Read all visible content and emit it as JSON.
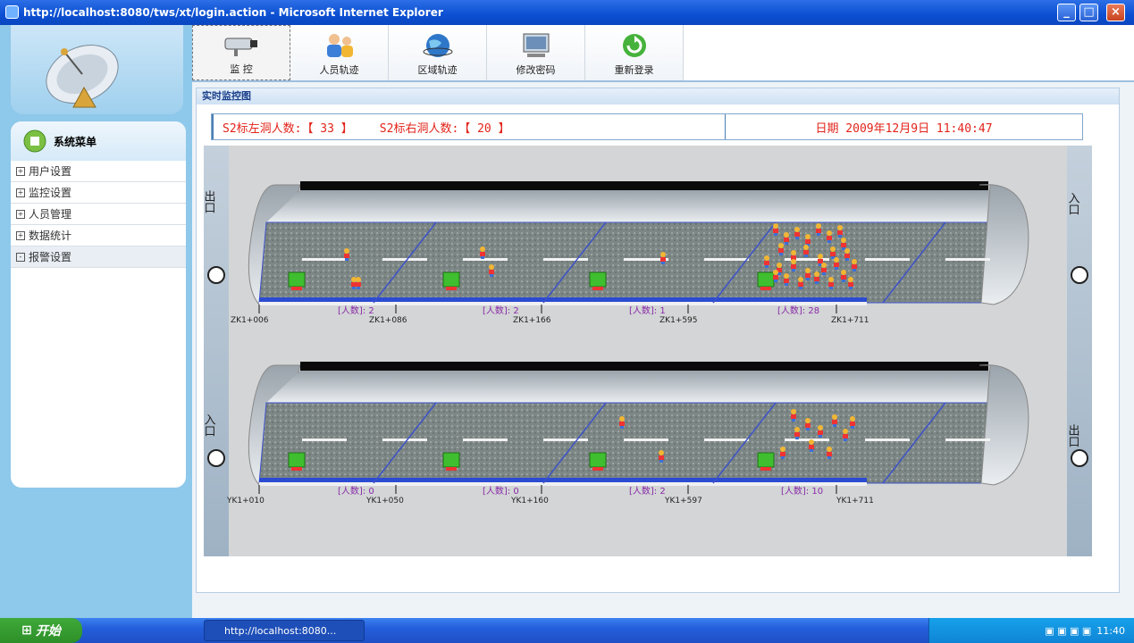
{
  "window": {
    "title": "http://localhost:8080/tws/xt/login.action - Microsoft Internet Explorer"
  },
  "tabs": [
    {
      "label": "监  控",
      "icon": "camera-icon"
    },
    {
      "label": "人员轨迹",
      "icon": "people-icon"
    },
    {
      "label": "区域轨迹",
      "icon": "globe-icon"
    },
    {
      "label": "修改密码",
      "icon": "computer-icon"
    },
    {
      "label": "重新登录",
      "icon": "refresh-icon"
    }
  ],
  "sidebar": {
    "title": "系统菜单",
    "items": [
      {
        "label": "用户设置",
        "sign": "+"
      },
      {
        "label": "监控设置",
        "sign": "+"
      },
      {
        "label": "人员管理",
        "sign": "+"
      },
      {
        "label": "数据统计",
        "sign": "+"
      },
      {
        "label": "报警设置",
        "sign": "-"
      }
    ]
  },
  "panel": {
    "title": "实时监控图"
  },
  "info": {
    "left_count": "S2标左洞人数:【 33 】",
    "right_count": "S2标右洞人数:【 20 】",
    "date": "日期 2009年12月9日 11:40:47"
  },
  "tunnel_left": {
    "labels": {
      "exit": "出口",
      "entry": "入口"
    },
    "stations": [
      "ZK1+006",
      "ZK1+086",
      "ZK1+166",
      "ZK1+595",
      "ZK1+711"
    ],
    "counts": [
      "[人数]: 2",
      "[人数]: 2",
      "[人数]: 1",
      "[人数]: 28"
    ]
  },
  "tunnel_right": {
    "labels": {
      "exit": "出口",
      "entry": "入口"
    },
    "stations": [
      "YK1+010",
      "YK1+050",
      "YK1+160",
      "YK1+597",
      "YK1+711"
    ],
    "counts": [
      "[人数]: 0",
      "[人数]: 0",
      "[人数]: 2",
      "[人数]: 10"
    ]
  },
  "taskbar": {
    "start": "开始",
    "task": "http://localhost:8080...",
    "clock": "11:40"
  }
}
